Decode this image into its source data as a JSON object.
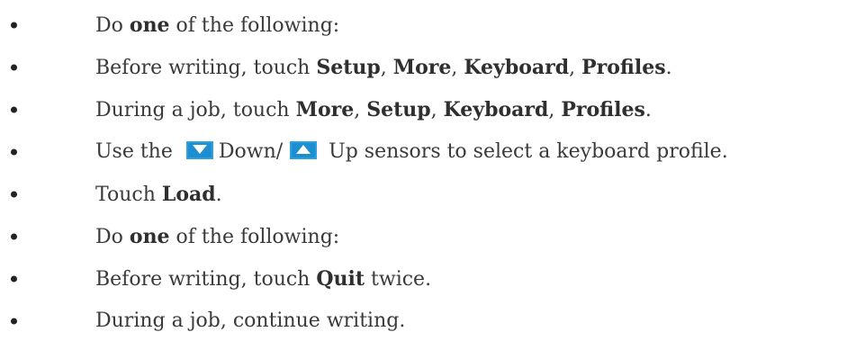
{
  "steps": [
    {
      "pre": "Do ",
      "b1": "one",
      "mid": " of the following:"
    },
    {
      "pre": "Before writing, touch ",
      "b1": "Setup",
      "sep1": ", ",
      "b2": "More",
      "sep2": ", ",
      "b3": "Keyboard",
      "sep3": ", ",
      "b4": "Profiles",
      "post": "."
    },
    {
      "pre": "During a job, touch ",
      "b1": "More",
      "sep1": ", ",
      "b2": "Setup",
      "sep2": ", ",
      "b3": "Keyboard",
      "sep3": ", ",
      "b4": "Profiles",
      "post": "."
    },
    {
      "pre": "Use the ",
      "down": "Down/",
      "up": " Up sensors to select a keyboard profile."
    },
    {
      "pre": "Touch ",
      "b1": "Load",
      "post": "."
    },
    {
      "pre": "Do ",
      "b1": "one",
      "mid": " of the following:"
    },
    {
      "pre": "Before writing, touch ",
      "b1": "Quit",
      "post": " twice."
    },
    {
      "pre": "During a job, continue writing."
    }
  ],
  "icons": {
    "down_sensor": "down-triangle-icon",
    "up_sensor": "up-triangle-icon",
    "sensor_color": "#1d8fd0"
  }
}
